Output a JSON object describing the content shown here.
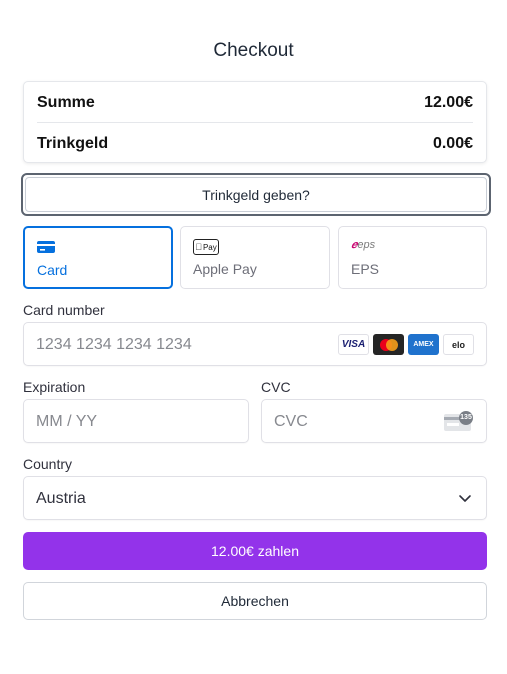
{
  "header": {
    "title": "Checkout"
  },
  "summary": {
    "rows": [
      {
        "label": "Summe",
        "value": "12.00€"
      },
      {
        "label": "Trinkgeld",
        "value": "0.00€"
      }
    ]
  },
  "tip_button": {
    "label": "Trinkgeld geben?"
  },
  "payment_methods": [
    {
      "label": "Card",
      "icon": "card-icon",
      "selected": true
    },
    {
      "label": "Apple Pay",
      "icon": "apple-pay-icon",
      "icon_text": "Pay",
      "selected": false
    },
    {
      "label": "EPS",
      "icon": "eps-icon",
      "icon_text": "eps",
      "selected": false
    }
  ],
  "card_number": {
    "label": "Card number",
    "placeholder": "1234 1234 1234 1234"
  },
  "card_brands": [
    {
      "name": "visa-icon",
      "text": "VISA"
    },
    {
      "name": "mastercard-icon",
      "text": ""
    },
    {
      "name": "amex-icon",
      "text": "AMEX"
    },
    {
      "name": "elo-icon",
      "text": "elo"
    }
  ],
  "expiration": {
    "label": "Expiration",
    "placeholder": "MM / YY"
  },
  "cvc": {
    "label": "CVC",
    "placeholder": "CVC",
    "icon_text": "135"
  },
  "country": {
    "label": "Country",
    "value": "Austria"
  },
  "pay_button": {
    "label": "12.00€ zahlen"
  },
  "cancel_button": {
    "label": "Abbrechen"
  },
  "colors": {
    "accent": "#0570de",
    "pay_button": "#9333ea"
  }
}
